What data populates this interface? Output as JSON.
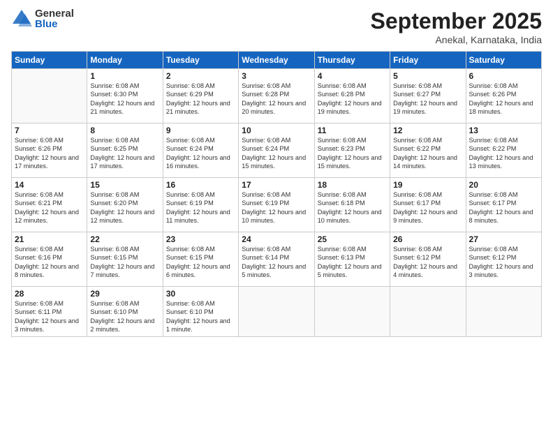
{
  "logo": {
    "general": "General",
    "blue": "Blue"
  },
  "title": "September 2025",
  "location": "Anekal, Karnataka, India",
  "weekdays": [
    "Sunday",
    "Monday",
    "Tuesday",
    "Wednesday",
    "Thursday",
    "Friday",
    "Saturday"
  ],
  "weeks": [
    [
      null,
      {
        "day": "1",
        "sunrise": "Sunrise: 6:08 AM",
        "sunset": "Sunset: 6:30 PM",
        "daylight": "Daylight: 12 hours and 21 minutes."
      },
      {
        "day": "2",
        "sunrise": "Sunrise: 6:08 AM",
        "sunset": "Sunset: 6:29 PM",
        "daylight": "Daylight: 12 hours and 21 minutes."
      },
      {
        "day": "3",
        "sunrise": "Sunrise: 6:08 AM",
        "sunset": "Sunset: 6:28 PM",
        "daylight": "Daylight: 12 hours and 20 minutes."
      },
      {
        "day": "4",
        "sunrise": "Sunrise: 6:08 AM",
        "sunset": "Sunset: 6:28 PM",
        "daylight": "Daylight: 12 hours and 19 minutes."
      },
      {
        "day": "5",
        "sunrise": "Sunrise: 6:08 AM",
        "sunset": "Sunset: 6:27 PM",
        "daylight": "Daylight: 12 hours and 19 minutes."
      },
      {
        "day": "6",
        "sunrise": "Sunrise: 6:08 AM",
        "sunset": "Sunset: 6:26 PM",
        "daylight": "Daylight: 12 hours and 18 minutes."
      }
    ],
    [
      {
        "day": "7",
        "sunrise": "Sunrise: 6:08 AM",
        "sunset": "Sunset: 6:26 PM",
        "daylight": "Daylight: 12 hours and 17 minutes."
      },
      {
        "day": "8",
        "sunrise": "Sunrise: 6:08 AM",
        "sunset": "Sunset: 6:25 PM",
        "daylight": "Daylight: 12 hours and 17 minutes."
      },
      {
        "day": "9",
        "sunrise": "Sunrise: 6:08 AM",
        "sunset": "Sunset: 6:24 PM",
        "daylight": "Daylight: 12 hours and 16 minutes."
      },
      {
        "day": "10",
        "sunrise": "Sunrise: 6:08 AM",
        "sunset": "Sunset: 6:24 PM",
        "daylight": "Daylight: 12 hours and 15 minutes."
      },
      {
        "day": "11",
        "sunrise": "Sunrise: 6:08 AM",
        "sunset": "Sunset: 6:23 PM",
        "daylight": "Daylight: 12 hours and 15 minutes."
      },
      {
        "day": "12",
        "sunrise": "Sunrise: 6:08 AM",
        "sunset": "Sunset: 6:22 PM",
        "daylight": "Daylight: 12 hours and 14 minutes."
      },
      {
        "day": "13",
        "sunrise": "Sunrise: 6:08 AM",
        "sunset": "Sunset: 6:22 PM",
        "daylight": "Daylight: 12 hours and 13 minutes."
      }
    ],
    [
      {
        "day": "14",
        "sunrise": "Sunrise: 6:08 AM",
        "sunset": "Sunset: 6:21 PM",
        "daylight": "Daylight: 12 hours and 12 minutes."
      },
      {
        "day": "15",
        "sunrise": "Sunrise: 6:08 AM",
        "sunset": "Sunset: 6:20 PM",
        "daylight": "Daylight: 12 hours and 12 minutes."
      },
      {
        "day": "16",
        "sunrise": "Sunrise: 6:08 AM",
        "sunset": "Sunset: 6:19 PM",
        "daylight": "Daylight: 12 hours and 11 minutes."
      },
      {
        "day": "17",
        "sunrise": "Sunrise: 6:08 AM",
        "sunset": "Sunset: 6:19 PM",
        "daylight": "Daylight: 12 hours and 10 minutes."
      },
      {
        "day": "18",
        "sunrise": "Sunrise: 6:08 AM",
        "sunset": "Sunset: 6:18 PM",
        "daylight": "Daylight: 12 hours and 10 minutes."
      },
      {
        "day": "19",
        "sunrise": "Sunrise: 6:08 AM",
        "sunset": "Sunset: 6:17 PM",
        "daylight": "Daylight: 12 hours and 9 minutes."
      },
      {
        "day": "20",
        "sunrise": "Sunrise: 6:08 AM",
        "sunset": "Sunset: 6:17 PM",
        "daylight": "Daylight: 12 hours and 8 minutes."
      }
    ],
    [
      {
        "day": "21",
        "sunrise": "Sunrise: 6:08 AM",
        "sunset": "Sunset: 6:16 PM",
        "daylight": "Daylight: 12 hours and 8 minutes."
      },
      {
        "day": "22",
        "sunrise": "Sunrise: 6:08 AM",
        "sunset": "Sunset: 6:15 PM",
        "daylight": "Daylight: 12 hours and 7 minutes."
      },
      {
        "day": "23",
        "sunrise": "Sunrise: 6:08 AM",
        "sunset": "Sunset: 6:15 PM",
        "daylight": "Daylight: 12 hours and 6 minutes."
      },
      {
        "day": "24",
        "sunrise": "Sunrise: 6:08 AM",
        "sunset": "Sunset: 6:14 PM",
        "daylight": "Daylight: 12 hours and 5 minutes."
      },
      {
        "day": "25",
        "sunrise": "Sunrise: 6:08 AM",
        "sunset": "Sunset: 6:13 PM",
        "daylight": "Daylight: 12 hours and 5 minutes."
      },
      {
        "day": "26",
        "sunrise": "Sunrise: 6:08 AM",
        "sunset": "Sunset: 6:12 PM",
        "daylight": "Daylight: 12 hours and 4 minutes."
      },
      {
        "day": "27",
        "sunrise": "Sunrise: 6:08 AM",
        "sunset": "Sunset: 6:12 PM",
        "daylight": "Daylight: 12 hours and 3 minutes."
      }
    ],
    [
      {
        "day": "28",
        "sunrise": "Sunrise: 6:08 AM",
        "sunset": "Sunset: 6:11 PM",
        "daylight": "Daylight: 12 hours and 3 minutes."
      },
      {
        "day": "29",
        "sunrise": "Sunrise: 6:08 AM",
        "sunset": "Sunset: 6:10 PM",
        "daylight": "Daylight: 12 hours and 2 minutes."
      },
      {
        "day": "30",
        "sunrise": "Sunrise: 6:08 AM",
        "sunset": "Sunset: 6:10 PM",
        "daylight": "Daylight: 12 hours and 1 minute."
      },
      null,
      null,
      null,
      null
    ]
  ]
}
